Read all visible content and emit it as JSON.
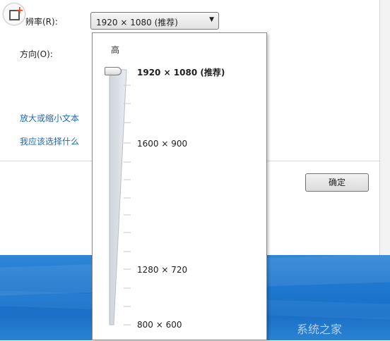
{
  "dialog": {
    "resolution_label": "辨率(R):",
    "orientation_label": "方向(O):",
    "resolution_value": "1920 × 1080 (推荐)",
    "links": [
      "放大或缩小文本",
      "我应该选择什么"
    ],
    "ok_button": "确定"
  },
  "resolution_popup": {
    "high_label": "高",
    "options": [
      {
        "label": "1920 × 1080 (推荐)",
        "selected": true
      },
      {
        "label": "1600 × 900",
        "selected": false
      },
      {
        "label": "1280 × 720",
        "selected": false
      },
      {
        "label": "800 × 600",
        "selected": false
      }
    ],
    "slider_value": "1920 × 1080 (推荐)"
  },
  "desktop": {
    "partial_text": "系统之家"
  },
  "colors": {
    "link": "#2068b8",
    "desktop_blue": "#1f78cf",
    "badge_plus": "#e8421e"
  },
  "icons": {
    "corner_badge": "add-window-icon",
    "dropdown_arrow": "triangle-down-icon"
  }
}
